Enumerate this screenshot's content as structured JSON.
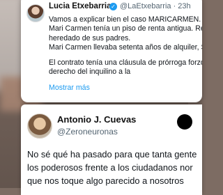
{
  "tweet1": {
    "author_name": "Lucia Etxebarria",
    "handle_time": "@LaEtxebarria · 23h",
    "lines": [
      "Vamos a explicar bien el caso MARICARMEN.",
      "Mari Carmen tenía un piso de renta antigua. Re",
      "heredado de sus padres.",
      "Mari Carmen llevaba setenta años de alquiler, S"
    ],
    "lines2": [
      "El contrato tenía una cláusula de prórroga forzo",
      "derecho del inquilino a la"
    ],
    "show_more": "Mostrar más"
  },
  "tweet2": {
    "author_name": "Antonio J. Cuevas",
    "handle": "@Zeroneuronas",
    "lines": [
      "No sé qué ha pasado para que tanta gente",
      "los poderosos frente a los ciudadanos nor",
      "que nos toque algo parecido a nosotros"
    ]
  }
}
